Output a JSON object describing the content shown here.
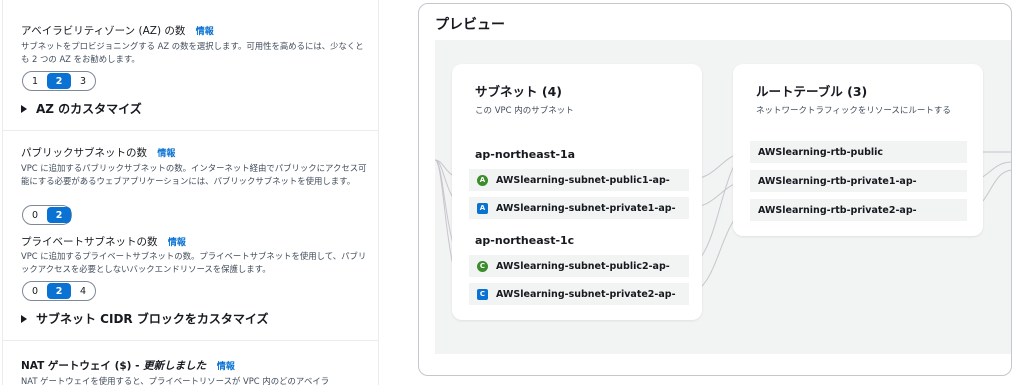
{
  "settings": {
    "az": {
      "title": "アベイラビリティゾーン (AZ) の数",
      "info": "情報",
      "desc": "サブネットをプロビジョニングする AZ の数を選択します。可用性を高めるには、少なくとも 2 つの AZ をお勧めします。",
      "options": [
        "1",
        "2",
        "3"
      ],
      "selected": "2",
      "customize": "AZ のカスタマイズ"
    },
    "public": {
      "title": "パブリックサブネットの数",
      "info": "情報",
      "desc": "VPC に追加するパブリックサブネットの数。インターネット経由でパブリックにアクセス可能にする必要があるウェブアプリケーションには、パブリックサブネットを使用します。",
      "options": [
        "0",
        "2"
      ],
      "selected": "2"
    },
    "private": {
      "title": "プライベートサブネットの数",
      "info": "情報",
      "desc": "VPC に追加するプライベートサブネットの数。プライベートサブネットを使用して、パブリックアクセスを必要としないバックエンドリソースを保護します。",
      "options": [
        "0",
        "2",
        "4"
      ],
      "selected": "2",
      "customize": "サブネット CIDR ブロックをカスタマイズ"
    },
    "nat": {
      "title": "NAT ゲートウェイ ($) - ",
      "title_em": "更新しました",
      "info": "情報",
      "desc": "NAT ゲートウェイを使用すると、プライベートリソースが VPC 内のどのアベイラ"
    }
  },
  "preview": {
    "title": "プレビュー",
    "subnets": {
      "title": "サブネット (4)",
      "subtitle": "この VPC 内のサブネット",
      "groups": [
        {
          "az": "ap-northeast-1a",
          "items": [
            {
              "badge": "A",
              "type": "public",
              "name": "AWSlearning-subnet-public1-ap-"
            },
            {
              "badge": "A",
              "type": "private",
              "name": "AWSlearning-subnet-private1-ap-"
            }
          ]
        },
        {
          "az": "ap-northeast-1c",
          "items": [
            {
              "badge": "C",
              "type": "public",
              "name": "AWSlearning-subnet-public2-ap-"
            },
            {
              "badge": "C",
              "type": "private",
              "name": "AWSlearning-subnet-private2-ap-"
            }
          ]
        }
      ]
    },
    "route_tables": {
      "title": "ルートテーブル (3)",
      "subtitle": "ネットワークトラフィックをリソースにルートする",
      "items": [
        "AWSlearning-rtb-public",
        "AWSlearning-rtb-private1-ap-",
        "AWSlearning-rtb-private2-ap-"
      ]
    }
  },
  "colors": {
    "accent": "#0972d3",
    "public_badge": "#3b8d2c",
    "private_badge": "#0972d3",
    "canvas_bg": "#f2f3f3"
  }
}
